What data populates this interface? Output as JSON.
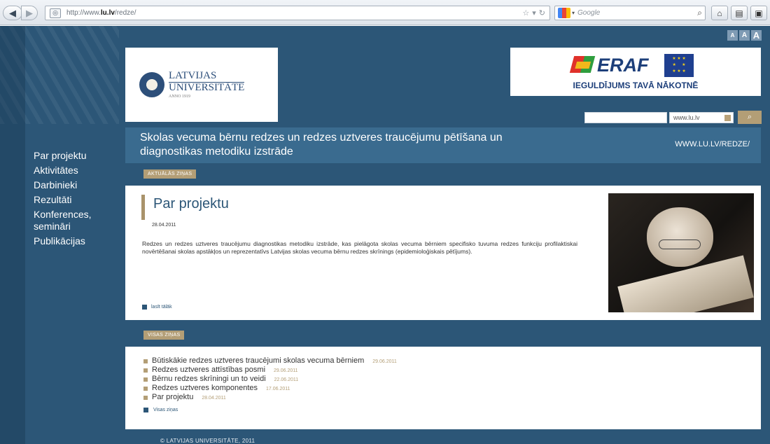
{
  "browser": {
    "url_prefix": "http://www.",
    "url_domain": "lu.lv",
    "url_path": "/redze/",
    "search_placeholder": "Google",
    "icons": [
      "back-icon",
      "forward-icon",
      "site-icon",
      "star-icon",
      "reload-icon",
      "google-logo-icon",
      "search-icon",
      "home-icon",
      "print-icon"
    ]
  },
  "header": {
    "font_sizes": [
      "A",
      "A",
      "A"
    ],
    "lu_logo": {
      "line1": "LATVIJAS",
      "line2": "UNIVERSITĀTE",
      "line3": "ANNO 1919"
    },
    "eraf": {
      "word": "ERAF",
      "slogan": "IEGULDĪJUMS TAVĀ NĀKOTNĒ"
    },
    "site_search": {
      "select_value": "www.lu.lv",
      "button_icon": "search-icon"
    },
    "title": "Skolas vecuma bērnu redzes un redzes uztveres traucējumu pētīšana un diagnostikas metodiku izstrāde",
    "title_url": "WWW.LU.LV/REDZE/"
  },
  "sidebar": {
    "items": [
      {
        "label": "Par projektu"
      },
      {
        "label": "Aktivitātes"
      },
      {
        "label": "Darbinieki"
      },
      {
        "label": "Rezultāti"
      },
      {
        "label": "Konferences, semināri"
      },
      {
        "label": "Publikācijas"
      }
    ]
  },
  "news": {
    "section_label": "AKTUĀLĀS ZIŅAS",
    "article": {
      "title": "Par projektu",
      "date": "28.04.2011",
      "body": "Redzes un redzes uztveres traucējumu diagnostikas metodiku izstrāde, kas pielāgota skolas vecuma bērniem specifisko tuvuma redzes funkciju profilaktiskai novērtēšanai skolas apstākļos un reprezentatīvs Latvijas skolas vecuma bērnu redzes skrīnings (epidemioloģiskais pētījums).",
      "read_more": "lasīt tālāk"
    }
  },
  "all_news": {
    "section_label": "VISAS ZIŅAS",
    "items": [
      {
        "title": "Būtiskākie redzes uztveres traucējumi skolas vecuma bērniem",
        "date": "29.06.2011"
      },
      {
        "title": "Redzes uztveres attīstības posmi",
        "date": "29.06.2011"
      },
      {
        "title": "Bērnu redzes skrīningi un to veidi",
        "date": "22.06.2011"
      },
      {
        "title": "Redzes uztveres komponentes",
        "date": "17.06.2011"
      },
      {
        "title": "Par projektu",
        "date": "28.04.2011"
      }
    ],
    "all_link": "Visas ziņas"
  },
  "footer": {
    "text": "© LATVIJAS UNIVERSITĀTE, 2011"
  },
  "colors": {
    "page_bg": "#2c5677",
    "accent": "#b39e76",
    "title_band": "#3a6b8f"
  }
}
